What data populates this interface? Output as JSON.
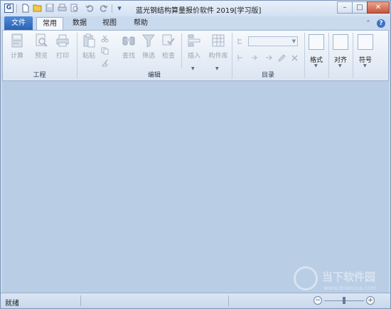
{
  "window": {
    "title": "蓝光钢结构算量报价软件 2019[学习版]",
    "app_icon_letter": "G"
  },
  "quick_access": [
    "new-icon",
    "open-icon",
    "save-icon",
    "print-icon",
    "preview-icon",
    "undo-icon",
    "redo-icon",
    "customize-icon"
  ],
  "tabs": {
    "file": "文件",
    "items": [
      {
        "label": "常用",
        "active": true
      },
      {
        "label": "数据",
        "active": false
      },
      {
        "label": "视图",
        "active": false
      },
      {
        "label": "帮助",
        "active": false
      }
    ]
  },
  "ribbon": {
    "groups": [
      {
        "name": "工程",
        "tools": [
          "计算",
          "预览",
          "打印"
        ]
      },
      {
        "name": "编辑",
        "tools": [
          "粘贴",
          "查找",
          "筛选",
          "检查",
          "插入",
          "构件库"
        ]
      },
      {
        "name": "目录",
        "tools": []
      },
      {
        "name": "",
        "tools": [
          "格式"
        ]
      },
      {
        "name": "",
        "tools": [
          "对齐"
        ]
      },
      {
        "name": "",
        "tools": [
          "符号"
        ]
      }
    ]
  },
  "status": {
    "text": "就绪"
  },
  "watermark": {
    "name": "当下软件园",
    "url": "www.downxia.com"
  },
  "colors": {
    "accent": "#2c62b3",
    "workspace": "#b9cde5",
    "close_button": "#c8553c"
  }
}
